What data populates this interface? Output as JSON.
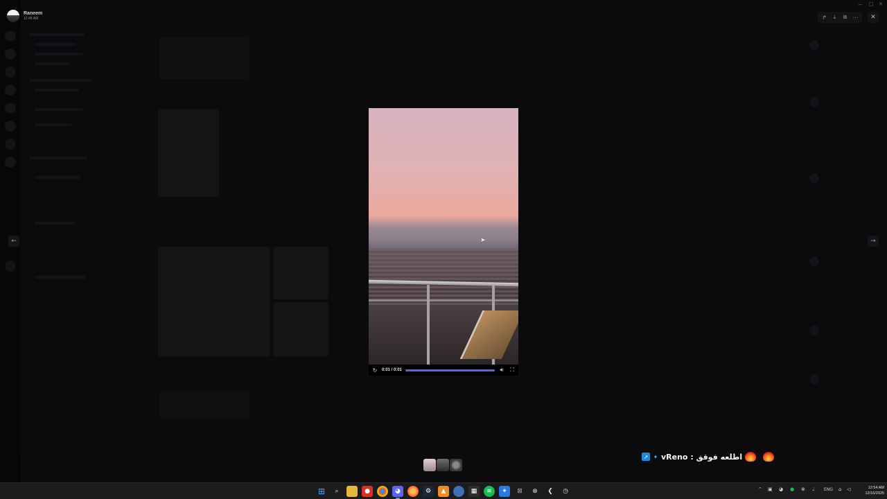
{
  "user": {
    "name": "Raneem",
    "time": "12:48 AM"
  },
  "viewer_toolbar": {
    "icons": [
      "forward-icon",
      "download-icon",
      "open-external-icon",
      "more-icon"
    ],
    "close": "close-icon"
  },
  "nav": {
    "prev": "arrow-left-icon",
    "next": "arrow-right-icon"
  },
  "video": {
    "time": "0:01 / 0:01",
    "progress": 1.0,
    "accent": "#5865f2"
  },
  "overlay": {
    "text": "vReno : اطلعه فوقق"
  },
  "taskbar": {
    "apps": [
      "start-icon",
      "search-icon",
      "file-explorer-icon",
      "recorder-icon",
      "chrome-icon",
      "discord-icon",
      "firefox-icon",
      "steam-icon",
      "vlc-icon",
      "app-icon",
      "terminal-icon",
      "spotify-icon",
      "app-icon-2",
      "excel-icon",
      "xbox-icon",
      "back-icon",
      "clock-app-icon"
    ],
    "language": "ENG",
    "clock_time": "12:54 AM",
    "clock_date": "12/16/2025"
  }
}
